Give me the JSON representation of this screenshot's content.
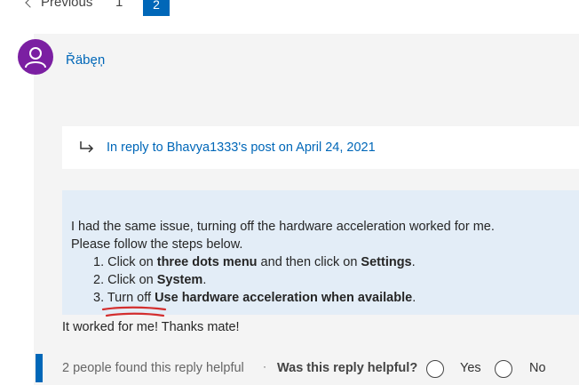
{
  "pagination": {
    "previous_label": "Previous",
    "pages": [
      "1",
      "2"
    ],
    "current_page": "2"
  },
  "post": {
    "author": "Řäbęņ",
    "avatar_color": "#7b1fa2",
    "in_reply_to": "In reply to Bhavya1333's post on April 24, 2021",
    "quote": {
      "line1": "I had the same issue, turning off the hardware acceleration worked for me.",
      "line2": "Please follow the steps below.",
      "steps": [
        {
          "prefix": "1. Click on ",
          "bold": "three dots menu",
          "middle": " and then click on ",
          "bold2": "Settings",
          "suffix": "."
        },
        {
          "prefix": "2. Click on ",
          "bold": "System",
          "suffix": "."
        },
        {
          "prefix": "3. Turn off ",
          "bold": "Use hardware acceleration when available",
          "suffix": "."
        }
      ]
    },
    "followup": "It worked for me! Thanks mate!"
  },
  "footer": {
    "helpful_count": "2 people found this reply helpful",
    "separator": "·",
    "question": "Was this reply helpful?",
    "yes_label": "Yes",
    "no_label": "No"
  },
  "colors": {
    "accent": "#0067b8",
    "quote_bg": "#e3edf7",
    "annotation": "#d32f2f"
  }
}
